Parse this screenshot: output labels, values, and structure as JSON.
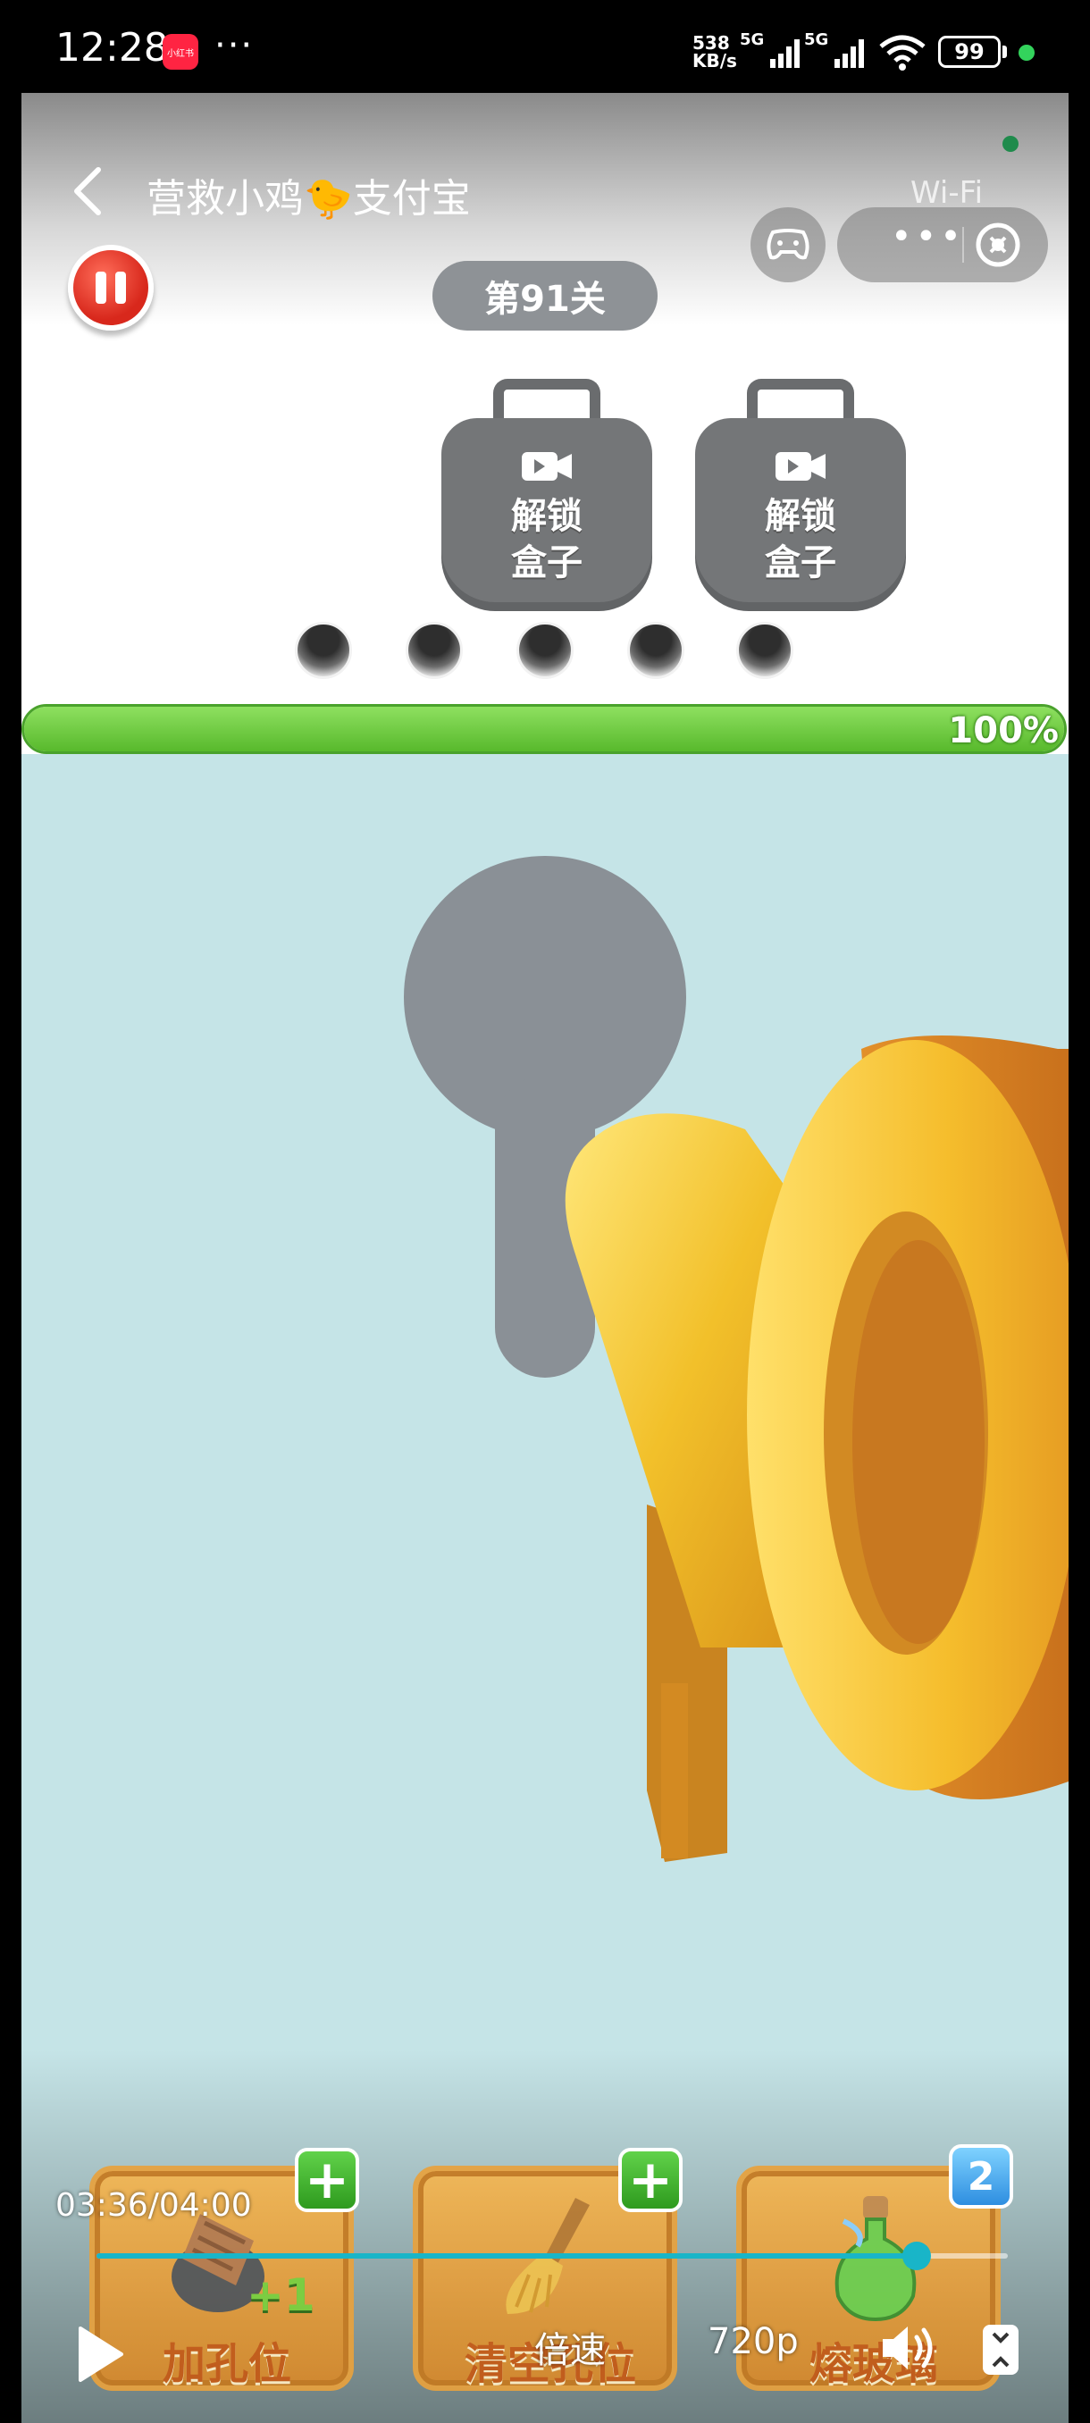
{
  "status_bar": {
    "time": "12:28",
    "app_icon_text": "小红书",
    "more": "···",
    "net_speed_value": "538",
    "net_speed_unit": "KB/s",
    "sim1": "5G",
    "sim2": "5G",
    "battery": "99"
  },
  "header": {
    "title": "营救小鸡🐤支付宝",
    "wifi_label": "Wi-Fi",
    "more_label": "•••"
  },
  "game": {
    "level": "第91关",
    "boxes": [
      {
        "label": "解锁\n盒子"
      },
      {
        "label": "解锁\n盒子"
      }
    ],
    "hole_count": 5,
    "progress_value": 1.0,
    "progress_text": "100%",
    "items": [
      {
        "label": "加孔位",
        "badge": "+",
        "bonus": "+1"
      },
      {
        "label": "清空孔位",
        "badge": "+"
      },
      {
        "label": "熔玻璃",
        "count": "2"
      }
    ],
    "colors": {
      "scene_bg": "#c5e4e7",
      "key_gold": "#f2c02a",
      "keyhole": "#8a9096",
      "progress": "#6cc93a"
    }
  },
  "video": {
    "time": "03:36/04:00",
    "position_fraction": 0.9,
    "speed_label": "倍速",
    "quality_label": "720p"
  }
}
